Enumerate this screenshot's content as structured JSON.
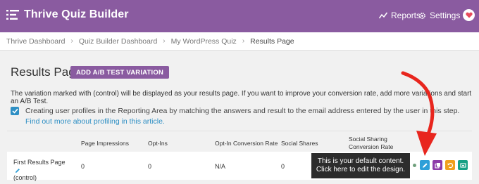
{
  "header": {
    "app_title": "Thrive Quiz Builder",
    "nav": {
      "reports_label": "Reports",
      "settings_label": "Settings"
    },
    "colors": {
      "bar": "#8a5ba0"
    }
  },
  "breadcrumb": [
    "Thrive Dashboard",
    "Quiz Builder Dashboard",
    "My WordPress Quiz",
    "Results Page"
  ],
  "page": {
    "title": "Results Page",
    "ab_button_label": "ADD A/B TEST VARIATION",
    "info_text": "The variation marked with (control) will be displayed as your results page. If you want to improve your conversion rate, add more variations and start an A/B Test.",
    "checkbox": {
      "checked": true,
      "label": "Creating user profiles in the Reporting Area by matching the answers and result to the email address entered by the user in this step.",
      "link_text": "Find out more about profiling in this article."
    }
  },
  "table": {
    "headers": [
      "Page Impressions",
      "Opt-Ins",
      "Opt-In Conversion Rate",
      "Social Shares",
      "Social Sharing Conversion Rate"
    ],
    "rows": [
      {
        "name": "First Results Page",
        "tag": "(control)",
        "impressions": "0",
        "optins": "0",
        "conversion_rate": "N/A",
        "social_shares": "0"
      }
    ]
  },
  "tooltip": {
    "line1": "This is your default content.",
    "line2": "Click here to edit the design."
  },
  "actions": [
    {
      "icon": "pencil-icon",
      "color": "#2e9fd8"
    },
    {
      "icon": "copy-icon",
      "color": "#8e3aa8"
    },
    {
      "icon": "reset-icon",
      "color": "#f0a01c"
    },
    {
      "icon": "trophy-icon",
      "color": "#16a085"
    }
  ]
}
